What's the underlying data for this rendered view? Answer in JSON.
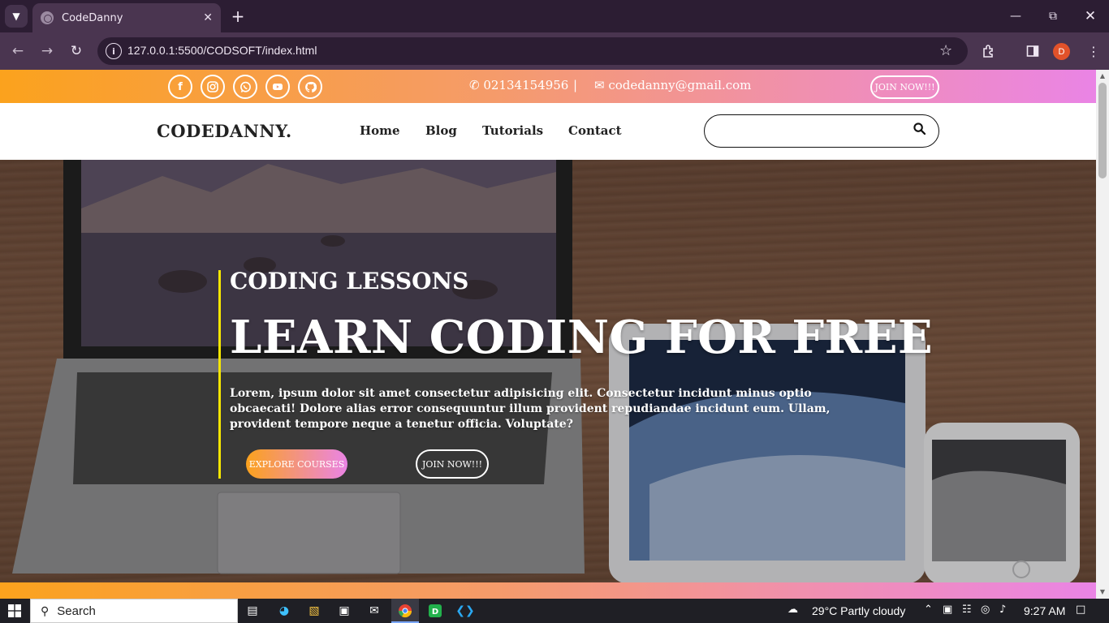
{
  "browser": {
    "tab_title": "CodeDanny",
    "url": "127.0.0.1:5500/CODSOFT/index.html",
    "profile_initial": "D",
    "icons": [
      "tab-search-icon",
      "close-icon",
      "new-tab-icon",
      "minimize-icon",
      "restore-icon",
      "close-window-icon",
      "back-icon",
      "forward-icon",
      "reload-icon",
      "site-info-icon",
      "bookmark-star-icon",
      "extensions-icon",
      "side-panel-icon",
      "menu-icon"
    ]
  },
  "topbar": {
    "social_icons": [
      "facebook-icon",
      "instagram-icon",
      "whatsapp-icon",
      "youtube-icon",
      "github-icon"
    ],
    "phone": "02134154956",
    "separator": "|",
    "email": "codedanny@gmail.com",
    "join_label": "JOIN NOW!!!",
    "gradient": [
      "#fba21d",
      "#f08fb2",
      "#ea84e5"
    ]
  },
  "navbar": {
    "brand": "CODEDANNY.",
    "links": [
      "Home",
      "Blog",
      "Tutorials",
      "Contact"
    ],
    "search_placeholder": ""
  },
  "hero": {
    "subtitle": "CODING LESSONS",
    "title": "LEARN CODING FOR FREE",
    "text": "Lorem, ipsum dolor sit amet consectetur adipisicing elit. Consectetur incidunt minus optio obcaecati! Dolore alias error consequuntur illum provident repudiandae incidunt eum. Ullam, provident tempore neque a tenetur officia. Voluptate?",
    "explore_label": "EXPLORE COURSES",
    "join_label": "JOIN NOW!!!",
    "accent_color": "#f5e600"
  },
  "taskbar": {
    "search_label": "Search",
    "weather": "29°C  Partly cloudy",
    "time": "9:27 AM"
  }
}
